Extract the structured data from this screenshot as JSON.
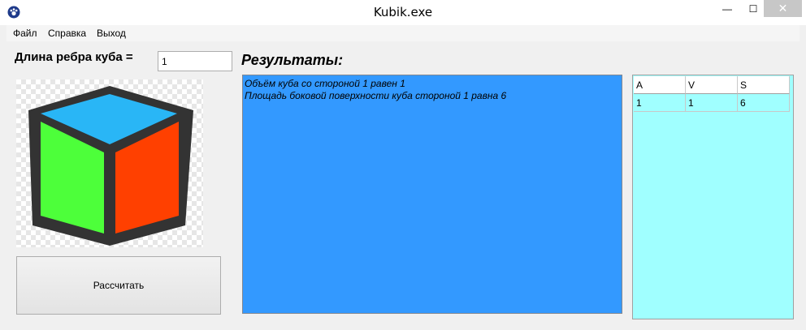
{
  "window": {
    "title": "Kubik.exe",
    "minimize_glyph": "—",
    "maximize_glyph": "☐",
    "close_glyph": "✕",
    "app_icon": "paw-icon"
  },
  "menu": {
    "items": [
      "Файл",
      "Справка",
      "Выход"
    ]
  },
  "input": {
    "label": "Длина ребра куба =",
    "value": "1"
  },
  "cube_image": {
    "icon": "cube-icon",
    "colors": {
      "top": "#29b6f6",
      "left": "#4dff3a",
      "right": "#ff4000",
      "outline": "#333333"
    }
  },
  "calculate_button": "Рассчитать",
  "results": {
    "label": "Результаты:",
    "lines": [
      "Объём куба со стороной 1 равен 1",
      "Площадь боковой поверхности куба стороной 1 равна 6"
    ],
    "background": "#3399ff"
  },
  "grid": {
    "columns": [
      "A",
      "V",
      "S"
    ],
    "rows": [
      [
        "1",
        "1",
        "6"
      ]
    ],
    "background": "#a0ffff"
  }
}
